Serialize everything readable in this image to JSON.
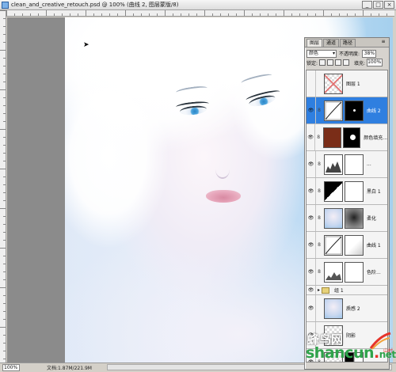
{
  "window": {
    "title": "clean_and_creative_retouch.psd @ 100% (曲线 2, 图层蒙版/8)",
    "buttons": [
      "_",
      "□",
      "×"
    ]
  },
  "status": {
    "zoom": "100%",
    "doc_info": "文档:1.87M/221.9M"
  },
  "layers_panel": {
    "tabs": [
      "图层",
      "通道",
      "路径"
    ],
    "blend_mode": "颜色",
    "opacity_label": "不透明度:",
    "opacity_value": "38%",
    "lock_label": "锁定:",
    "fill_label": "填充:",
    "fill_value": "100%",
    "layers": [
      {
        "name": "图层 1",
        "visible": false,
        "thumb": "transparent-x",
        "mask": false,
        "selected": false
      },
      {
        "name": "曲线 2",
        "visible": true,
        "thumb": "curves",
        "mask": "black",
        "selected": true
      },
      {
        "name": "颜色填充...",
        "visible": true,
        "thumb": "brown",
        "mask": "black-spot",
        "selected": false
      },
      {
        "name": "...",
        "visible": true,
        "thumb": "levels",
        "mask": "white",
        "selected": false
      },
      {
        "name": "黑白 1",
        "visible": true,
        "thumb": "bw",
        "mask": "white",
        "selected": false
      },
      {
        "name": "柔化",
        "visible": true,
        "thumb": "portrait",
        "mask": "gray",
        "selected": false
      },
      {
        "name": "曲线 1",
        "visible": true,
        "thumb": "curves",
        "mask": "white-fade",
        "selected": false
      },
      {
        "name": "色阶...",
        "visible": true,
        "thumb": "levels2",
        "mask": "white",
        "selected": false
      },
      {
        "name": "组 1",
        "type": "group",
        "visible": true
      },
      {
        "name": "质感 2",
        "visible": true,
        "thumb": "portrait",
        "mask": false,
        "selected": false
      },
      {
        "name": "阴影",
        "visible": true,
        "thumb": "transparent",
        "mask": false,
        "selected": false
      },
      {
        "name": "",
        "visible": true,
        "thumb": "transparent",
        "mask": "black-white",
        "selected": false
      }
    ]
  },
  "watermark": {
    "cn": "蜂鸟网",
    "en_left": "shancun",
    "en_dot": ".",
    "en_right": "net",
    "cn_small": "山村"
  },
  "colors": {
    "selection": "#2f7fe0",
    "panel_bg": "#d6d3ce",
    "watermark_green": "#2fa34b",
    "watermark_red": "#e6342a"
  }
}
